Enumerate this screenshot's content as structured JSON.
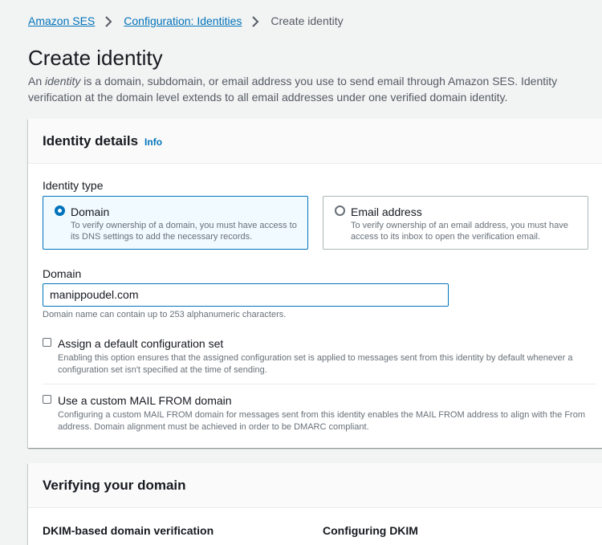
{
  "breadcrumb": {
    "items": [
      "Amazon SES",
      "Configuration: Identities"
    ],
    "current": "Create identity"
  },
  "page": {
    "title": "Create identity",
    "description_parts": [
      "An ",
      "identity",
      " is a domain, subdomain, or email address you use to send email through Amazon SES. Identity verification at the domain level extends to all email addresses under one verified domain identity."
    ]
  },
  "identity_details": {
    "title": "Identity details",
    "info_label": "Info",
    "identity_type_label": "Identity type",
    "options": [
      {
        "title": "Domain",
        "description": "To verify ownership of a domain, you must have access to its DNS settings to add the necessary records.",
        "selected": true
      },
      {
        "title": "Email address",
        "description": "To verify ownership of an email address, you must have access to its inbox to open the verification email.",
        "selected": false
      }
    ],
    "domain_label": "Domain",
    "domain_value": "manippoudel.com",
    "domain_hint": "Domain name can contain up to 253 alphanumeric characters.",
    "checkboxes": [
      {
        "title": "Assign a default configuration set",
        "description": "Enabling this option ensures that the assigned configuration set is applied to messages sent from this identity by default whenever a configuration set isn't specified at the time of sending.",
        "checked": false
      },
      {
        "title": "Use a custom MAIL FROM domain",
        "description": "Configuring a custom MAIL FROM domain for messages sent from this identity enables the MAIL FROM address to align with the From address. Domain alignment must be achieved in order to be DMARC compliant.",
        "checked": false
      }
    ]
  },
  "verifying": {
    "title": "Verifying your domain",
    "left_heading": "DKIM-based domain verification",
    "right_heading": "Configuring DKIM"
  },
  "colors": {
    "link": "#0073bb",
    "background": "#f2f3f3",
    "selected_tile_bg": "#f1faff"
  }
}
